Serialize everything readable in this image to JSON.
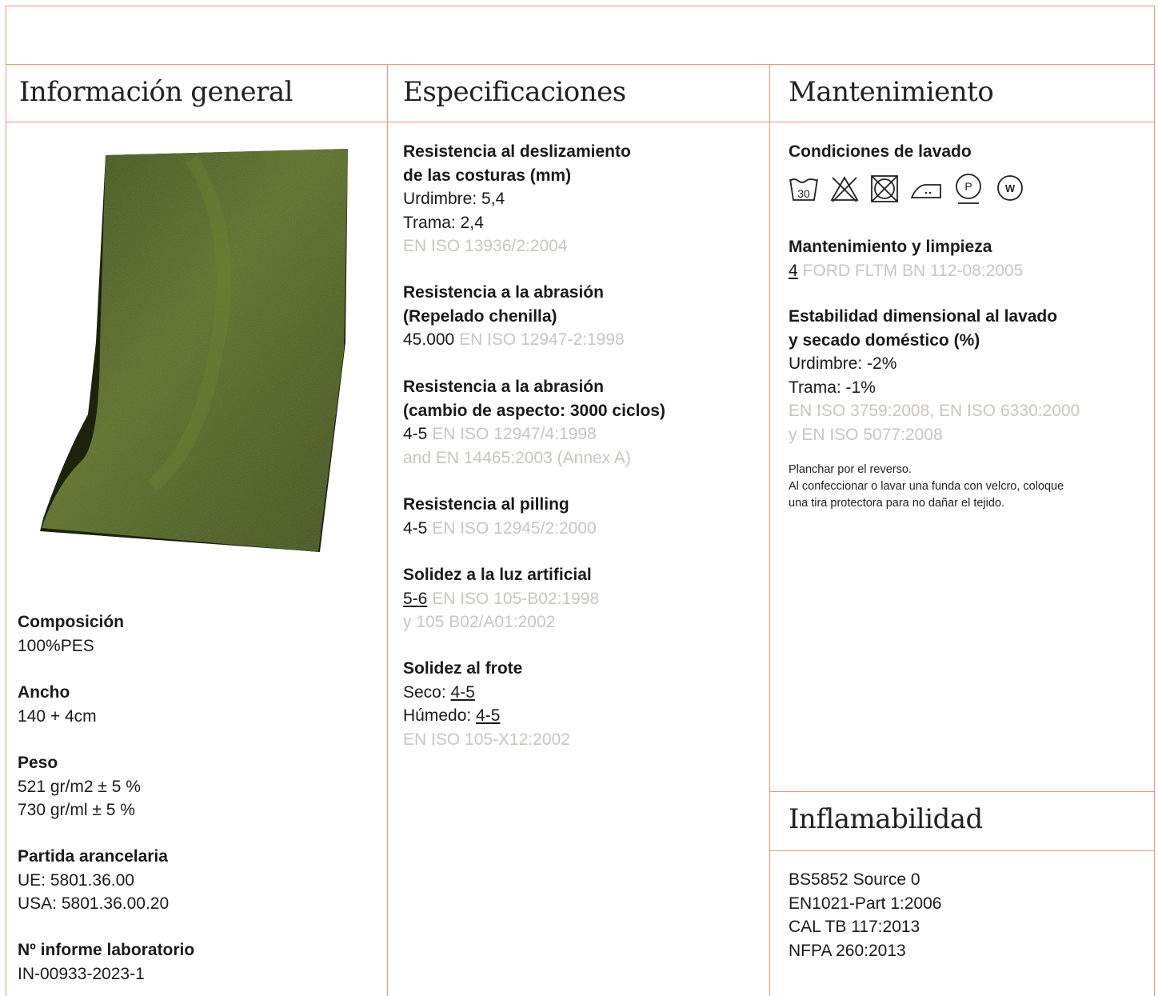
{
  "columns": {
    "general": {
      "title": "Información general",
      "composition": {
        "label": "Composición",
        "value": "100%PES"
      },
      "width": {
        "label": "Ancho",
        "value": "140 + 4cm"
      },
      "weight": {
        "label": "Peso",
        "values": [
          "521 gr/m2 ± 5 %",
          "730 gr/ml ± 5 %"
        ]
      },
      "tariff": {
        "label": "Partida arancelaria",
        "values": [
          "UE: 5801.36.00",
          "USA: 5801.36.00.20"
        ]
      },
      "lab_report": {
        "label": "Nº informe laboratorio",
        "value": "IN-00933-2023-1"
      }
    },
    "specs": {
      "title": "Especificaciones",
      "seam_slippage": {
        "label_lines": [
          "Resistencia al deslizamiento",
          "de las costuras (mm)"
        ],
        "warp": "Urdimbre: 5,4",
        "weft": "Trama: 2,4",
        "standard": "EN ISO 13936/2:2004"
      },
      "abrasion_chenille": {
        "label_lines": [
          "Resistencia a la abrasión",
          "(Repelado chenilla)"
        ],
        "value": "45.000",
        "standard": "EN ISO 12947-2:1998"
      },
      "abrasion_appearance": {
        "label_lines": [
          "Resistencia a la abrasión",
          "(cambio de aspecto: 3000 ciclos)"
        ],
        "value": "4-5",
        "standard_lines": [
          "EN ISO 12947/4:1998",
          "and EN 14465:2003 (Annex A)"
        ]
      },
      "pilling": {
        "label": "Resistencia al pilling",
        "value": "4-5",
        "standard": "EN ISO 12945/2:2000"
      },
      "light_fastness": {
        "label": "Solidez a la luz artificial",
        "value": "5-6",
        "standard_lines": [
          "EN ISO 105-B02:1998",
          "y 105 B02/A01:2002"
        ]
      },
      "rubbing": {
        "label": "Solidez al frote",
        "dry_label": "Seco: ",
        "dry_value": "4-5",
        "wet_label": "Húmedo: ",
        "wet_value": "4-5",
        "standard": "EN ISO 105-X12:2002"
      }
    },
    "care": {
      "title": "Mantenimiento",
      "washing": {
        "label": "Condiciones de lavado",
        "icons": [
          "wash-30-icon",
          "do-not-bleach-icon",
          "do-not-tumble-dry-icon",
          "iron-low-icon",
          "dry-clean-p-icon",
          "wet-clean-w-icon"
        ],
        "wash_temp": "30",
        "dry_clean_letter": "P",
        "wet_clean_letter": "W"
      },
      "cleaning": {
        "label": "Mantenimiento y limpieza",
        "value": "4",
        "standard": "FORD FLTM BN 112-08:2005"
      },
      "stability": {
        "label_lines": [
          "Estabilidad dimensional al lavado",
          "y secado doméstico (%)"
        ],
        "warp": "Urdimbre: -2%",
        "weft": "Trama: -1%",
        "standard_lines": [
          "EN ISO 3759:2008, EN ISO 6330:2000",
          "y EN ISO 5077:2008"
        ]
      },
      "notes": [
        "Planchar por el reverso.",
        "Al confeccionar o lavar una funda con velcro, coloque",
        "una tira protectora para no dañar el tejido."
      ]
    },
    "flammability": {
      "title": "Inflamabilidad",
      "values": [
        "BS5852 Source 0",
        "EN1021-Part 1:2006",
        "CAL TB 117:2013",
        "NFPA 260:2013"
      ]
    }
  },
  "colors": {
    "border": "#e8967a",
    "standard_text": "#c9c6c0",
    "fabric": "#4a5a1c"
  }
}
